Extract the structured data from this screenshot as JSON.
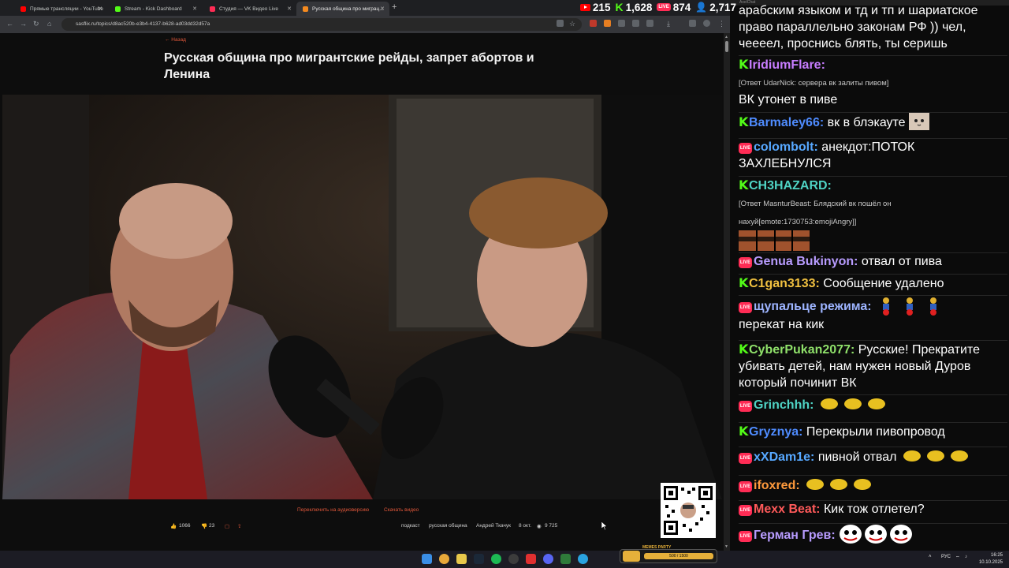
{
  "browser": {
    "tabs": [
      {
        "label": "Прямые трансляции - YouTube",
        "color": "#ff0000"
      },
      {
        "label": "Stream - Kick Dashboard",
        "color": "#53fc18"
      },
      {
        "label": "Студия — VK Видео Live",
        "color": "#ff2c55"
      },
      {
        "label": "Русская община про миграц...",
        "color": "#f58a1f"
      }
    ],
    "new_tab": "+",
    "url": "sasflix.ru/topics/d8ac520b-e3b4-4137-b628-ad03dd32d57a"
  },
  "counters": {
    "youtube": "215",
    "kick": "1,628",
    "vk": "874",
    "total": "2,717",
    "live_badge": "LIVE"
  },
  "page": {
    "back": "← Назад",
    "title": "Русская община про мигрантские рейды, запрет абортов и Ленина",
    "audio_link": "Переключить на аудиоверсию",
    "download_link": "Скачать видео",
    "likes": "1066",
    "dislikes": "23",
    "tags": [
      "подкаст",
      "русская община",
      "Андрей Ткачук"
    ],
    "date": "8 окт.",
    "views": "9 725"
  },
  "chat": {
    "header": "AxelChat",
    "top_text": "арабским языком и тд и тп и шариатское право параллельно законам РФ )) чел, чееeел, проснись блять, ты серишь",
    "messages": [
      {
        "platform": "kick",
        "user": "IridiumFlare:",
        "color": "#c77dff",
        "reply": "[Ответ UdarNick: сервера вк залиты пивом]",
        "text": "ВК утонет в пиве"
      },
      {
        "platform": "kick",
        "user": "Barmaley66:",
        "color": "#4f8cff",
        "text": "вк в блэкауте"
      },
      {
        "platform": "vk",
        "user": "colombolt:",
        "color": "#57a8ff",
        "text": "анекдот:ПОТОК ЗАХЛЕБНУЛСЯ"
      },
      {
        "platform": "kick",
        "user": "CH3HAZARD:",
        "color": "#4fd3c4",
        "reply": "[Ответ MasnturBeast: Блядский вк пошёл он нахуй[emote:1730753:emojiAngry]]",
        "text": ""
      },
      {
        "platform": "vk",
        "user": "Genua Bukinyon:",
        "color": "#b89cff",
        "text": "отвал от пива"
      },
      {
        "platform": "kick",
        "user": "C1gan3133:",
        "color": "#f0c040",
        "text": "Сообщение удалено"
      },
      {
        "platform": "vk",
        "user": "щупальце режима:",
        "color": "#9db4ff",
        "text": "перекат на кик"
      },
      {
        "platform": "kick",
        "user": "CyberPukan2077:",
        "color": "#8fe06a",
        "text": "Русские! Прекратите убивать детей, нам нужен новый Дуров который починит ВК"
      },
      {
        "platform": "vk",
        "user": "Grinchhh:",
        "color": "#4fd3c4",
        "text": ""
      },
      {
        "platform": "kick",
        "user": "Gryznya:",
        "color": "#4f8cff",
        "text": "Перекрыли пивопровод"
      },
      {
        "platform": "vk",
        "user": "xXDam1e:",
        "color": "#57a8ff",
        "text": "пивной отвал"
      },
      {
        "platform": "vk",
        "user": "ifoxred:",
        "color": "#ff9a3c",
        "text": ""
      },
      {
        "platform": "vk",
        "user": "Mexx Beat:",
        "color": "#ff5a5a",
        "text": "Кик тож отлетел?"
      },
      {
        "platform": "vk",
        "user": "Герман Грев:",
        "color": "#b89cff",
        "text": ""
      }
    ]
  },
  "taskbar": {
    "lang": "РУС",
    "time": "16:25",
    "date": "10.10.2025",
    "meme_label": "MEMES PARTY",
    "meme_progress": "500 / 1500"
  }
}
